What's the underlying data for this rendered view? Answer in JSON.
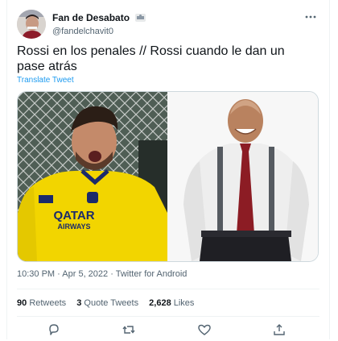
{
  "tweet": {
    "display_name": "Fan de Desabato",
    "handle": "@fandelchavit0",
    "text": "Rossi en los penales // Rossi cuando le dan un pase atrás",
    "translate_label": "Translate Tweet",
    "time": "10:30 PM",
    "date": "Apr 5, 2022",
    "separator": "·",
    "source": "Twitter for Android",
    "media": {
      "left_jersey_sponsor": "QATAR",
      "left_jersey_sponsor_sub": "AIRWAYS"
    },
    "stats": {
      "retweets_count": "90",
      "retweets_label": "Retweets",
      "quote_count": "3",
      "quote_label": "Quote Tweets",
      "likes_count": "2,628",
      "likes_label": "Likes"
    }
  },
  "icons": [
    "avatar",
    "badge-icon",
    "more-icon",
    "reply-icon",
    "retweet-icon",
    "like-icon",
    "share-icon"
  ],
  "colors": {
    "link": "#1d9bf0",
    "muted": "#536471",
    "text": "#0f1419",
    "jersey_yellow": "#f2d500"
  }
}
